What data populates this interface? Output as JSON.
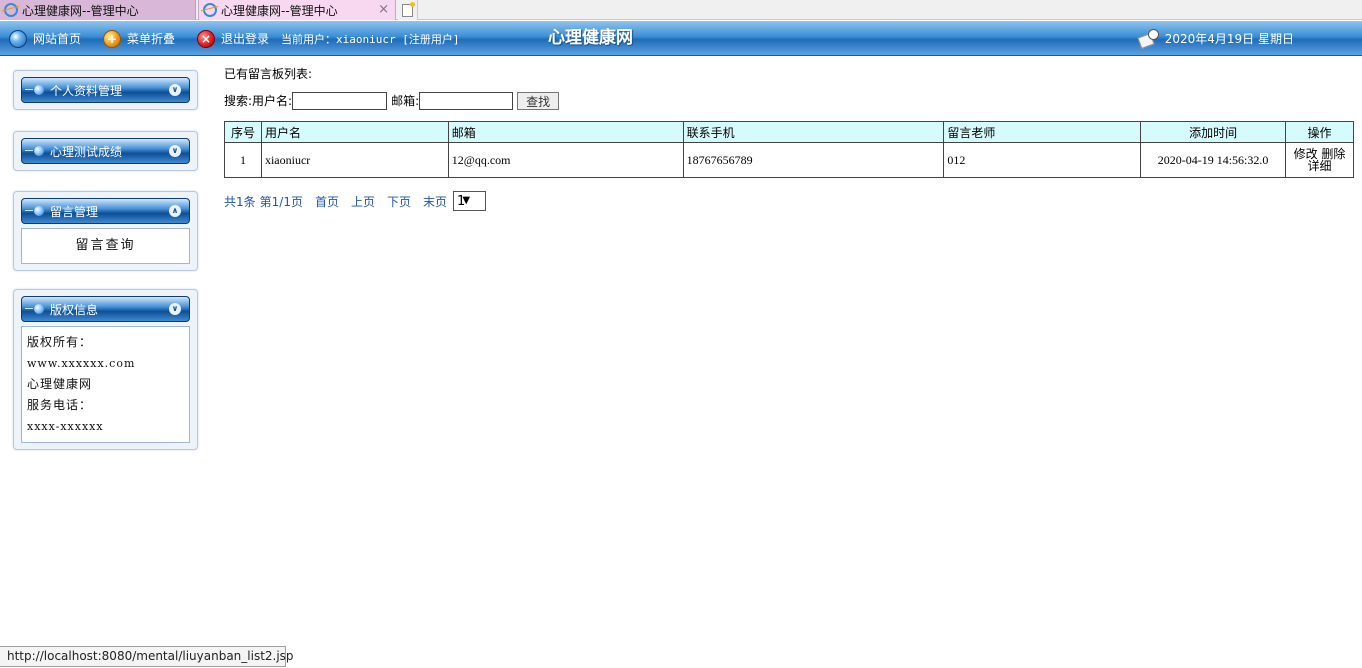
{
  "browser": {
    "tabs": [
      {
        "title": "心理健康网--管理中心",
        "active": false
      },
      {
        "title": "心理健康网--管理中心",
        "active": true
      }
    ],
    "close_glyph": "×",
    "status_url": "http://localhost:8080/mental/liuyanban_list2.jsp"
  },
  "header": {
    "home_label": "网站首页",
    "fold_label": "菜单折叠",
    "logout_label": "退出登录",
    "current_user_text": "当前用户：xiaoniucr [注册用户]",
    "site_title": "心理健康网",
    "date_text": "2020年4月19日  星期日"
  },
  "sidebar": {
    "panels": [
      {
        "title": "个人资料管理",
        "expanded": false,
        "icon": "chevron-down-icon"
      },
      {
        "title": "心理测试成绩",
        "expanded": false,
        "icon": "chevron-down-icon"
      },
      {
        "title": "留言管理",
        "expanded": true,
        "icon": "chevron-up-icon",
        "items": [
          "留言查询"
        ]
      },
      {
        "title": "版权信息",
        "expanded": true,
        "icon": "chevron-down-icon",
        "lines": [
          "版权所有：",
          "www.xxxxxx.com",
          "心理健康网",
          "服务电话：",
          "xxxx-xxxxxx"
        ]
      }
    ]
  },
  "main": {
    "list_title": "已有留言板列表:",
    "search": {
      "prefix": "搜索:",
      "username_label": "用户名:",
      "username_value": "",
      "email_label": "邮箱:",
      "email_value": "",
      "button_label": "查找"
    },
    "table": {
      "columns": [
        "序号",
        "用户名",
        "邮箱",
        "联系手机",
        "留言老师",
        "添加时间",
        "操作"
      ],
      "rows": [
        {
          "index": "1",
          "username": "xiaoniucr",
          "email": "12@qq.com",
          "phone": "18767656789",
          "teacher": "012",
          "added": "2020-04-19 14:56:32.0",
          "actions": {
            "edit": "修改",
            "delete": "删除",
            "detail": "详细"
          }
        }
      ]
    },
    "pager": {
      "total": "共1条",
      "page_info": "第1/1页",
      "first": "首页",
      "prev": "上页",
      "next": "下页",
      "last": "末页",
      "selected_page": "1"
    }
  },
  "colors": {
    "header_blue": "#1f6cb8",
    "table_header_bg": "#d6fbfd",
    "pager_link": "#1f56b0",
    "sidebar_bg": "#eef3fa"
  }
}
